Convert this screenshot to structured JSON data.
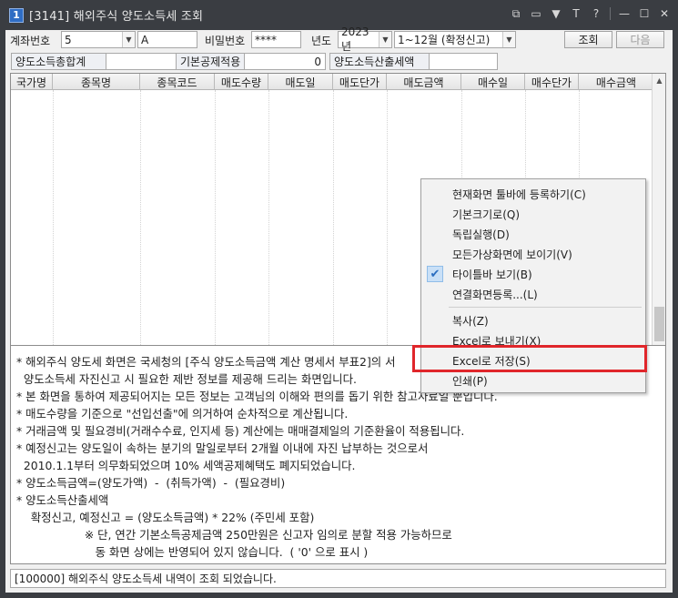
{
  "window": {
    "number": "1",
    "title": "[3141] 해외주식 양도소득세 조회",
    "icons": [
      "restore-icon",
      "layout-icon",
      "pin-icon",
      "text-icon",
      "help-icon",
      "minimize-icon",
      "maximize-icon",
      "close-icon"
    ],
    "icon_glyphs": [
      "⧉",
      "▭",
      "▼",
      "T",
      "?",
      "—",
      "☐",
      "✕"
    ]
  },
  "account": {
    "label": "계좌번호",
    "account_value": "5",
    "name_value": "A",
    "password_label": "비밀번호",
    "password_value": "****",
    "year_label": "년도",
    "year_value": "2023년",
    "period_value": "1~12월 (확정신고)",
    "query_button": "조회",
    "next_button": "다음"
  },
  "summary": {
    "total_label": "양도소득총합계",
    "total_value": "",
    "deduction_label": "기본공제적용",
    "deduction_value": "0",
    "tax_label": "양도소득산출세액",
    "tax_value": ""
  },
  "grid": {
    "columns": [
      "국가명",
      "종목명",
      "종목코드",
      "매도수량",
      "매도일",
      "매도단가",
      "매도금액",
      "매수일",
      "매수단가",
      "매수금액"
    ]
  },
  "context_menu": {
    "items": [
      {
        "label": "현재화면 툴바에 등록하기(C)",
        "checked": false
      },
      {
        "label": "기본크기로(Q)",
        "checked": false
      },
      {
        "label": "독립실행(D)",
        "checked": false
      },
      {
        "label": "모든가상화면에 보이기(V)",
        "checked": false
      },
      {
        "label": "타이틀바 보기(B)",
        "checked": true
      },
      {
        "label": "연결화면등록...(L)",
        "checked": false
      },
      {
        "label": "복사(Z)",
        "checked": false
      },
      {
        "label": "Excel로 보내기(X)",
        "checked": false
      },
      {
        "label": "Excel로 저장(S)",
        "checked": false
      },
      {
        "label": "인쇄(P)",
        "checked": false
      }
    ],
    "highlighted_item": "Excel로 저장(S)",
    "highlight_color": "#e0262b"
  },
  "notes": [
    "* 해외주식 양도세 화면은 국세청의 [주식 양도소득금액 계산 명세서 부표2]의 서",
    "  양도소득세 자진신고 시 필요한 제반 정보를 제공해 드리는 화면입니다.",
    "* 본 화면을 통하여 제공되어지는 모든 정보는 고객님의 이해와 편의를 돕기 위한 참고자료일 뿐입니다.",
    "* 매도수량을 기준으로 \"선입선출\"에 의거하여 순차적으로 계산됩니다.",
    "* 거래금액 및 필요경비(거래수수료, 인지세 등) 계산에는 매매결제일의 기준환율이 적용됩니다.",
    "* 예정신고는 양도일이 속하는 분기의 말일로부터 2개월 이내에 자진 납부하는 것으로서",
    "  2010.1.1부터 의무화되었으며 10% 세액공제혜택도 폐지되었습니다.",
    "* 양도소득금액=(양도가액)  -  (취득가액)  -  (필요경비)",
    "* 양도소득산출세액",
    "    확정신고, 예정신고 = (양도소득금액) * 22% (주민세 포함)",
    "                   ※ 단, 연간 기본소득공제금액 250만원은 신고자 임의로 분할 적용 가능하므로",
    "                      동 화면 상에는 반영되어 있지 않습니다.  ( '0' 으로 표시 )"
  ],
  "status": {
    "message": "[100000] 해외주식 양도소득세 내역이 조회 되었습니다."
  }
}
